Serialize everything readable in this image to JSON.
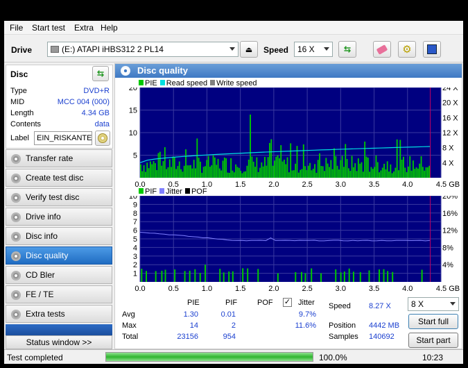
{
  "menu": [
    "File",
    "Start test",
    "Extra",
    "Help"
  ],
  "toolbar": {
    "drive_label": "Drive",
    "drive_value": "(E:)  ATAPI iHBS312   2 PL14",
    "speed_label": "Speed",
    "speed_value": "16 X"
  },
  "disc": {
    "header": "Disc",
    "rows": [
      {
        "label": "Type",
        "value": "DVD+R"
      },
      {
        "label": "MID",
        "value": "MCC 004 (000)"
      },
      {
        "label": "Length",
        "value": "4.34 GB"
      },
      {
        "label": "Contents",
        "value": "data"
      }
    ],
    "label_caption": "Label",
    "label_value": "EIN_RISKANTEI"
  },
  "nav": [
    {
      "label": "Transfer rate",
      "active": false
    },
    {
      "label": "Create test disc",
      "active": false
    },
    {
      "label": "Verify test disc",
      "active": false
    },
    {
      "label": "Drive info",
      "active": false
    },
    {
      "label": "Disc info",
      "active": false
    },
    {
      "label": "Disc quality",
      "active": true
    },
    {
      "label": "CD Bler",
      "active": false
    },
    {
      "label": "FE / TE",
      "active": false
    },
    {
      "label": "Extra tests",
      "active": false
    }
  ],
  "status_window_label": "Status window >>",
  "main_title": "Disc quality",
  "chart_data": [
    {
      "type": "bar",
      "legend": [
        "PIE",
        "Read speed",
        "Write speed"
      ],
      "x_ticks": [
        "0.0",
        "0.5",
        "1.0",
        "1.5",
        "2.0",
        "2.5",
        "3.0",
        "3.5",
        "4.0",
        "4.5 GB"
      ],
      "y_left_ticks": [
        "20",
        "15",
        "10",
        "5"
      ],
      "y_right_ticks": [
        "24 X",
        "20 X",
        "16 X",
        "12 X",
        "8 X",
        "4 X"
      ],
      "ylim": [
        0,
        20
      ],
      "xlim": [
        0,
        4.5
      ],
      "pie_avg": 1.3,
      "pie_max": 14,
      "read_speed_start_x": 4,
      "read_speed_end_x": 8.3,
      "colors": {
        "pie": "#00c800",
        "read": "#00e0e0",
        "write": "#808080",
        "bg": "#000080"
      }
    },
    {
      "type": "bar",
      "legend": [
        "PIF",
        "Jitter",
        "POF"
      ],
      "x_ticks": [
        "0.0",
        "0.5",
        "1.0",
        "1.5",
        "2.0",
        "2.5",
        "3.0",
        "3.5",
        "4.0",
        "4.5 GB"
      ],
      "y_left_ticks": [
        "10",
        "9",
        "8",
        "7",
        "6",
        "5",
        "4",
        "3",
        "2",
        "1"
      ],
      "y_right_ticks": [
        "20%",
        "16%",
        "12%",
        "8%",
        "4%"
      ],
      "ylim": [
        0,
        10
      ],
      "xlim": [
        0,
        4.5
      ],
      "pif_max": 2,
      "jitter_start_pct": 11.6,
      "jitter_end_pct": 9.6,
      "colors": {
        "pif": "#00c800",
        "jitter": "#8080ff",
        "pof": "#000000",
        "bg": "#000080"
      }
    }
  ],
  "stats": {
    "headers": [
      "PIE",
      "PIF",
      "POF",
      "Jitter"
    ],
    "rows": [
      {
        "label": "Avg",
        "pie": "1.30",
        "pif": "0.01",
        "jitter": "9.7%"
      },
      {
        "label": "Max",
        "pie": "14",
        "pif": "2",
        "jitter": "11.6%"
      },
      {
        "label": "Total",
        "pie": "23156",
        "pif": "954",
        "jitter": ""
      }
    ],
    "speed_label": "Speed",
    "speed_value": "8.27 X",
    "position_label": "Position",
    "position_value": "4442 MB",
    "samples_label": "Samples",
    "samples_value": "140692",
    "speed_select": "8 X",
    "start_full": "Start full",
    "start_part": "Start part"
  },
  "status": {
    "text": "Test completed",
    "progress_pct": 100.0,
    "progress_label": "100.0%",
    "time": "10:23"
  }
}
